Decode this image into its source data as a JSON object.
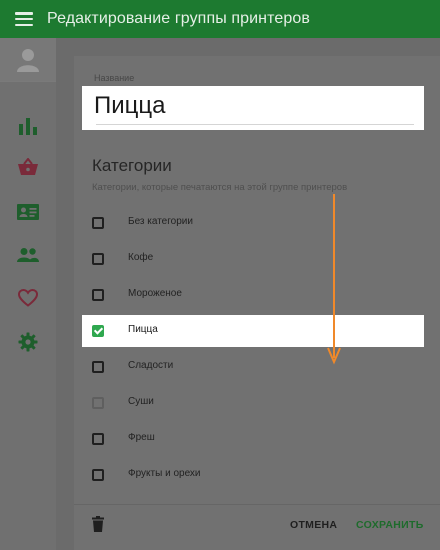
{
  "app": {
    "title": "Редактирование группы принтеров"
  },
  "form": {
    "name_label": "Название",
    "name_value": "Пицца",
    "categories_title": "Категории",
    "categories_subtitle": "Категории, которые печатаются на этой группе принтеров"
  },
  "categories": [
    {
      "label": "Без категории",
      "checked": false,
      "disabled": false,
      "selected": false
    },
    {
      "label": "Кофе",
      "checked": false,
      "disabled": false,
      "selected": false
    },
    {
      "label": "Мороженое",
      "checked": false,
      "disabled": false,
      "selected": false
    },
    {
      "label": "Пицца",
      "checked": true,
      "disabled": false,
      "selected": true
    },
    {
      "label": "Сладости",
      "checked": false,
      "disabled": false,
      "selected": false
    },
    {
      "label": "Суши",
      "checked": false,
      "disabled": true,
      "selected": false
    },
    {
      "label": "Фреш",
      "checked": false,
      "disabled": false,
      "selected": false
    },
    {
      "label": "Фрукты и орехи",
      "checked": false,
      "disabled": false,
      "selected": false
    }
  ],
  "actions": {
    "cancel": "ОТМЕНА",
    "save": "СОХРАНИТЬ"
  },
  "colors": {
    "topbar": "#1d7a30",
    "accent_green": "#2fa84f",
    "nav_green": "#1e5e2c",
    "nav_red": "#7a2a3a",
    "arrow": "#f0892a"
  },
  "icons": {
    "menu": "menu-icon",
    "avatar": "user-avatar-icon",
    "nav": [
      "bar-chart-icon",
      "basket-icon",
      "id-card-icon",
      "people-icon",
      "heart-icon",
      "gear-icon"
    ],
    "delete": "trash-icon"
  }
}
